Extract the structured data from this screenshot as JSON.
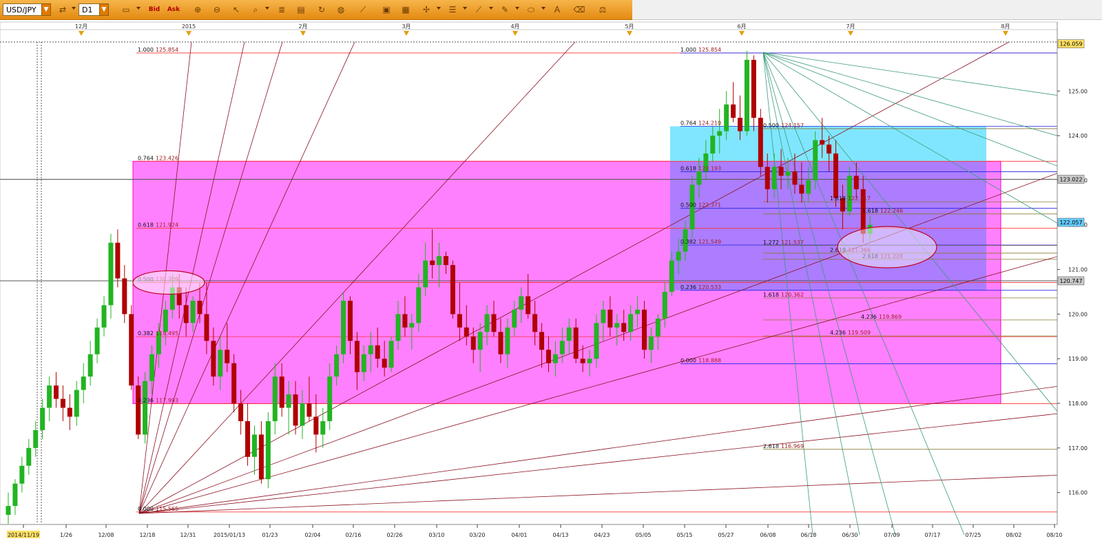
{
  "toolbar": {
    "symbol": "USD/JPY",
    "timeframe": "D1",
    "bid_label": "Bid",
    "ask_label": "Ask",
    "icons": [
      "chart-type-icon",
      "zoom-in-icon",
      "zoom-out-icon",
      "cursor-icon",
      "zoom-area-icon",
      "fibonacci-icon",
      "comment-icon",
      "rotate-icon",
      "globe-icon",
      "ruler-icon",
      "image-icon",
      "snapshot-icon",
      "crosshair-icon",
      "lines-icon",
      "trendline-icon",
      "pen-icon",
      "ellipse-icon",
      "text-icon",
      "eraser-icon",
      "ladder-icon"
    ]
  },
  "colors": {
    "bull": "#22b422",
    "bear": "#b00000",
    "magenta_box": "#ff80ff",
    "cyan_box": "#80e6ff",
    "purple_box": "#b46aff",
    "fib_line_red": "#ff3030",
    "fib_line_blue": "#2020e0",
    "fan_dark": "#8a1020",
    "fan_green": "#3a9a7a"
  },
  "chart_data": {
    "type": "candlestick",
    "symbol": "USD/JPY",
    "timeframe": "D1",
    "ylim": [
      115.3,
      126.1
    ],
    "y_ticks": [
      116.0,
      117.0,
      118.0,
      119.0,
      120.0,
      121.0,
      122.0,
      123.0,
      124.0,
      125.0
    ],
    "x_date_labels": [
      "2014/11/19",
      "1/26",
      "12/08",
      "12/18",
      "12/31",
      "2015/01/13",
      "01/23",
      "02/04",
      "02/16",
      "02/26",
      "03/10",
      "03/20",
      "04/01",
      "04/13",
      "04/23",
      "05/05",
      "05/15",
      "05/27",
      "06/08",
      "06/18",
      "06/30",
      "07/09",
      "07/17",
      "07/25",
      "08/02",
      "08/10"
    ],
    "month_labels": [
      "12月",
      "2015",
      "2月",
      "3月",
      "4月",
      "5月",
      "6月",
      "7月",
      "8月"
    ],
    "price_flags": [
      {
        "label": "126.059",
        "value": 126.059,
        "bg": "#ffe066"
      },
      {
        "label": "123.022",
        "value": 123.022,
        "bg": "#c8c8c8"
      },
      {
        "label": "122.057",
        "value": 122.057,
        "bg": "#66ccff"
      },
      {
        "label": "120.747",
        "value": 120.747,
        "bg": "#c8c8c8"
      }
    ],
    "horizontal_lines": [
      123.022,
      120.747
    ],
    "fib_left": [
      {
        "ratio": "1.000",
        "price": "125.854",
        "value": 125.854
      },
      {
        "ratio": "0.764",
        "price": "123.426",
        "value": 123.426
      },
      {
        "ratio": "0.618",
        "price": "121.924",
        "value": 121.924
      },
      {
        "ratio": "0.500",
        "price": "120.709",
        "value": 120.709
      },
      {
        "ratio": "0.382",
        "price": "119.495",
        "value": 119.495
      },
      {
        "ratio": "0.236",
        "price": "117.993",
        "value": 117.993
      },
      {
        "ratio": "0.000",
        "price": "115.565",
        "value": 115.565
      }
    ],
    "fib_right": [
      {
        "ratio": "1.000",
        "price": "125.854",
        "value": 125.854
      },
      {
        "ratio": "0.764",
        "price": "124.210",
        "value": 124.21
      },
      {
        "ratio": "0.618",
        "price": "123.193",
        "value": 123.193
      },
      {
        "ratio": "0.500",
        "price": "122.371",
        "value": 122.371
      },
      {
        "ratio": "0.382",
        "price": "121.549",
        "value": 121.549
      },
      {
        "ratio": "0.236",
        "price": "120.533",
        "value": 120.533
      },
      {
        "ratio": "0.000",
        "price": "118.888",
        "value": 118.888
      }
    ],
    "fib_ext": [
      {
        "ratio": "0.500",
        "price": "124.157",
        "value": 124.157
      },
      {
        "ratio": "1.618",
        "price": "122.517",
        "value": 122.517
      },
      {
        "ratio": "1.618",
        "price": "122.246",
        "value": 122.246
      },
      {
        "ratio": "1.272",
        "price": "121.537",
        "value": 121.537
      },
      {
        "ratio": "2.618",
        "price": "121.366",
        "value": 121.366
      },
      {
        "ratio": "2.618",
        "price": "121.228",
        "value": 121.228
      },
      {
        "ratio": "1.618",
        "price": "120.362",
        "value": 120.362
      },
      {
        "ratio": "4.236",
        "price": "119.869",
        "value": 119.869
      },
      {
        "ratio": "4.236",
        "price": "119.509",
        "value": 119.509
      },
      {
        "ratio": "2.618",
        "price": "116.969",
        "value": 116.969
      }
    ],
    "candles": [
      [
        115.5,
        116.0,
        115.3,
        115.7
      ],
      [
        115.7,
        116.3,
        115.5,
        116.2
      ],
      [
        116.2,
        116.8,
        116.0,
        116.6
      ],
      [
        116.6,
        117.2,
        116.4,
        117.0
      ],
      [
        117.0,
        117.6,
        116.8,
        117.4
      ],
      [
        117.4,
        118.1,
        117.2,
        117.9
      ],
      [
        117.9,
        118.6,
        117.6,
        118.4
      ],
      [
        118.4,
        118.7,
        117.9,
        118.1
      ],
      [
        118.1,
        118.4,
        117.6,
        117.9
      ],
      [
        117.9,
        118.2,
        117.4,
        117.7
      ],
      [
        117.7,
        118.5,
        117.5,
        118.3
      ],
      [
        118.3,
        118.9,
        118.0,
        118.6
      ],
      [
        118.6,
        119.4,
        118.4,
        119.1
      ],
      [
        119.1,
        119.9,
        118.9,
        119.7
      ],
      [
        119.7,
        120.4,
        119.5,
        120.2
      ],
      [
        120.2,
        121.8,
        119.9,
        121.6
      ],
      [
        121.6,
        121.9,
        120.6,
        120.8
      ],
      [
        120.8,
        121.1,
        119.8,
        120.0
      ],
      [
        120.0,
        120.2,
        118.3,
        118.4
      ],
      [
        118.4,
        118.6,
        117.2,
        117.3
      ],
      [
        117.3,
        118.7,
        117.1,
        118.5
      ],
      [
        118.5,
        119.3,
        118.2,
        119.1
      ],
      [
        119.1,
        119.8,
        118.8,
        119.6
      ],
      [
        119.6,
        120.3,
        119.3,
        120.1
      ],
      [
        120.1,
        120.9,
        119.9,
        120.6
      ],
      [
        120.6,
        120.9,
        119.9,
        120.2
      ],
      [
        120.2,
        120.6,
        119.5,
        119.8
      ],
      [
        119.8,
        120.4,
        119.6,
        120.3
      ],
      [
        120.3,
        120.7,
        119.8,
        120.0
      ],
      [
        120.0,
        120.7,
        119.1,
        119.4
      ],
      [
        119.4,
        119.7,
        118.4,
        118.6
      ],
      [
        118.6,
        119.5,
        118.3,
        119.2
      ],
      [
        119.2,
        119.8,
        118.7,
        118.9
      ],
      [
        118.9,
        119.1,
        117.8,
        118.0
      ],
      [
        118.0,
        118.3,
        117.3,
        117.6
      ],
      [
        117.6,
        118.0,
        116.6,
        116.8
      ],
      [
        116.8,
        117.5,
        116.4,
        117.3
      ],
      [
        117.3,
        117.6,
        116.2,
        116.3
      ],
      [
        116.3,
        117.8,
        116.1,
        117.6
      ],
      [
        117.6,
        118.9,
        117.3,
        118.6
      ],
      [
        118.6,
        118.9,
        117.7,
        117.9
      ],
      [
        117.9,
        118.5,
        117.3,
        118.2
      ],
      [
        118.2,
        118.5,
        117.3,
        117.5
      ],
      [
        117.5,
        118.3,
        117.2,
        118.0
      ],
      [
        118.0,
        118.6,
        117.6,
        117.7
      ],
      [
        117.7,
        118.2,
        116.9,
        117.3
      ],
      [
        117.3,
        117.9,
        117.0,
        117.6
      ],
      [
        117.6,
        118.9,
        117.4,
        118.6
      ],
      [
        118.6,
        119.3,
        118.4,
        119.1
      ],
      [
        119.1,
        120.5,
        118.9,
        120.3
      ],
      [
        120.3,
        120.4,
        119.1,
        119.4
      ],
      [
        119.4,
        119.6,
        118.3,
        118.7
      ],
      [
        118.7,
        119.3,
        118.5,
        119.1
      ],
      [
        119.1,
        119.6,
        118.7,
        119.3
      ],
      [
        119.3,
        119.7,
        118.8,
        119.0
      ],
      [
        119.0,
        119.4,
        118.6,
        118.8
      ],
      [
        118.8,
        119.5,
        118.7,
        119.4
      ],
      [
        119.4,
        120.3,
        119.2,
        120.0
      ],
      [
        120.0,
        120.4,
        119.5,
        119.7
      ],
      [
        119.7,
        120.0,
        119.2,
        119.8
      ],
      [
        119.8,
        120.9,
        119.6,
        120.6
      ],
      [
        120.6,
        121.6,
        120.4,
        121.2
      ],
      [
        121.2,
        121.9,
        120.8,
        121.1
      ],
      [
        121.1,
        121.6,
        120.6,
        121.3
      ],
      [
        121.3,
        121.4,
        120.9,
        121.1
      ],
      [
        121.1,
        121.2,
        119.9,
        120.0
      ],
      [
        120.0,
        120.7,
        119.4,
        119.7
      ],
      [
        119.7,
        120.2,
        119.3,
        119.5
      ],
      [
        119.5,
        119.7,
        118.9,
        119.2
      ],
      [
        119.2,
        119.8,
        118.7,
        119.6
      ],
      [
        119.6,
        120.2,
        119.3,
        120.0
      ],
      [
        120.0,
        120.3,
        119.5,
        119.6
      ],
      [
        119.6,
        119.9,
        118.9,
        119.1
      ],
      [
        119.1,
        119.9,
        118.8,
        119.7
      ],
      [
        119.7,
        120.3,
        119.5,
        120.1
      ],
      [
        120.1,
        120.6,
        119.8,
        120.4
      ],
      [
        120.4,
        120.9,
        119.9,
        120.0
      ],
      [
        120.0,
        120.3,
        119.3,
        119.6
      ],
      [
        119.6,
        119.8,
        118.8,
        119.2
      ],
      [
        119.2,
        119.5,
        118.7,
        118.9
      ],
      [
        118.9,
        119.4,
        118.6,
        119.1
      ],
      [
        119.1,
        119.7,
        118.9,
        119.4
      ],
      [
        119.4,
        119.9,
        119.1,
        119.7
      ],
      [
        119.7,
        119.9,
        118.9,
        119.0
      ],
      [
        119.0,
        119.3,
        118.7,
        118.9
      ],
      [
        118.9,
        119.2,
        118.6,
        119.0
      ],
      [
        119.0,
        120.0,
        118.8,
        119.8
      ],
      [
        119.8,
        120.3,
        119.4,
        120.1
      ],
      [
        120.1,
        120.4,
        119.5,
        119.7
      ],
      [
        119.7,
        120.0,
        119.3,
        119.8
      ],
      [
        119.8,
        120.1,
        119.4,
        119.6
      ],
      [
        119.6,
        120.2,
        119.4,
        120.0
      ],
      [
        120.0,
        120.4,
        119.7,
        120.1
      ],
      [
        120.1,
        120.3,
        119.0,
        119.2
      ],
      [
        119.2,
        119.7,
        118.9,
        119.5
      ],
      [
        119.5,
        120.0,
        119.2,
        119.9
      ],
      [
        119.9,
        120.7,
        119.7,
        120.5
      ],
      [
        120.5,
        121.4,
        120.4,
        121.2
      ],
      [
        121.2,
        121.7,
        120.9,
        121.4
      ],
      [
        121.4,
        122.1,
        121.2,
        121.9
      ],
      [
        121.9,
        123.1,
        121.7,
        122.9
      ],
      [
        122.9,
        123.5,
        122.6,
        123.2
      ],
      [
        123.2,
        123.9,
        123.0,
        123.6
      ],
      [
        123.6,
        124.2,
        123.4,
        124.0
      ],
      [
        124.0,
        124.6,
        123.6,
        124.1
      ],
      [
        124.1,
        125.0,
        123.9,
        124.7
      ],
      [
        124.7,
        125.2,
        124.3,
        124.4
      ],
      [
        124.4,
        124.9,
        123.9,
        124.1
      ],
      [
        124.1,
        125.9,
        124.0,
        125.7
      ],
      [
        125.7,
        125.8,
        124.1,
        124.4
      ],
      [
        124.4,
        124.6,
        123.1,
        123.3
      ],
      [
        123.3,
        123.6,
        122.5,
        122.8
      ],
      [
        122.8,
        123.6,
        122.6,
        123.3
      ],
      [
        123.3,
        123.7,
        122.8,
        123.1
      ],
      [
        123.1,
        123.5,
        122.8,
        123.2
      ],
      [
        123.2,
        123.6,
        122.7,
        122.9
      ],
      [
        122.9,
        123.4,
        122.5,
        122.7
      ],
      [
        122.7,
        123.3,
        122.5,
        123.0
      ],
      [
        123.0,
        124.1,
        122.8,
        123.9
      ],
      [
        123.9,
        124.4,
        123.5,
        123.8
      ],
      [
        123.8,
        124.0,
        123.2,
        123.6
      ],
      [
        123.6,
        123.9,
        122.4,
        122.6
      ],
      [
        122.6,
        122.9,
        121.9,
        122.3
      ],
      [
        122.3,
        123.3,
        122.2,
        123.1
      ],
      [
        123.1,
        123.4,
        122.6,
        122.8
      ],
      [
        122.8,
        123.1,
        121.6,
        121.8
      ],
      [
        121.8,
        122.2,
        121.6,
        122.0
      ]
    ]
  }
}
